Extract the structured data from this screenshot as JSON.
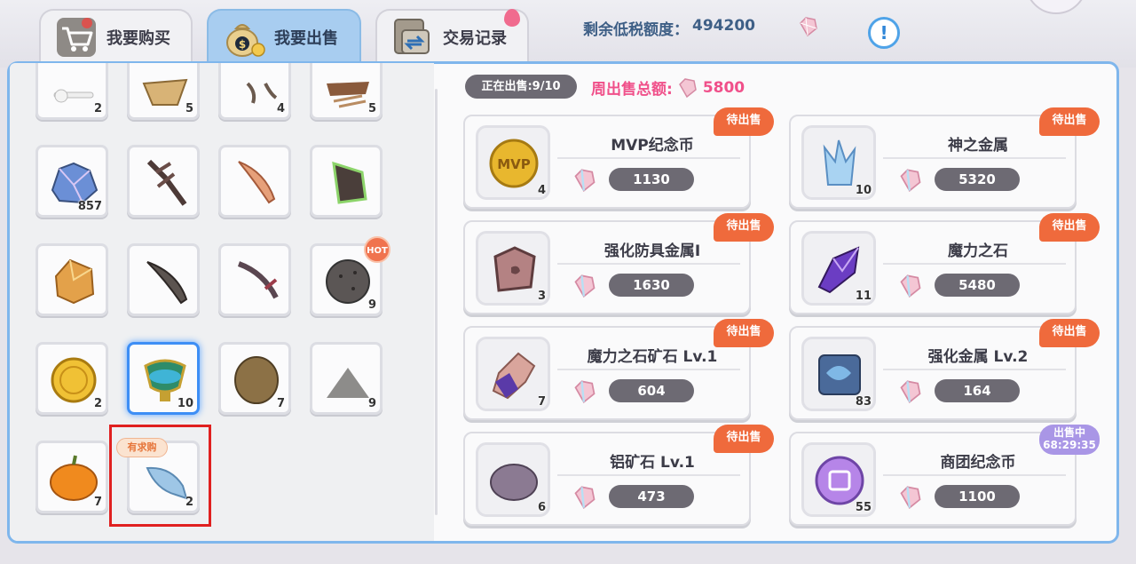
{
  "tabs": [
    {
      "label": "我要购买",
      "icon": "shopping-cart-icon"
    },
    {
      "label": "我要出售",
      "icon": "money-bag-icon"
    },
    {
      "label": "交易记录",
      "icon": "trade-record-icon"
    }
  ],
  "quota": {
    "label": "剩余低税额度：",
    "value": "494200"
  },
  "colors": {
    "accent": "#7fb6ec",
    "status_pending": "#ef6a3c",
    "status_selling": "#a996e6",
    "weekly_pink": "#f0508a"
  },
  "selling_status": "正在出售:9/10",
  "weekly_total": {
    "label": "周出售总额:",
    "value": "5800"
  },
  "inventory": {
    "hot_badge": "HOT",
    "buy_tag": "有求购",
    "slots": [
      {
        "icon": "bone-icon",
        "count": "2"
      },
      {
        "icon": "cloth-icon",
        "count": "5"
      },
      {
        "icon": "branch-icon",
        "count": "4"
      },
      {
        "icon": "wood-pile-icon",
        "count": "5"
      },
      {
        "icon": "crystal-ore-icon",
        "count": "857"
      },
      {
        "icon": "dark-sword-icon",
        "count": ""
      },
      {
        "icon": "flame-blade-icon",
        "count": ""
      },
      {
        "icon": "green-claw-icon",
        "count": ""
      },
      {
        "icon": "amber-stone-icon",
        "count": ""
      },
      {
        "icon": "scimitar-icon",
        "count": ""
      },
      {
        "icon": "dagger-icon",
        "count": ""
      },
      {
        "icon": "dark-orb-icon",
        "count": "9"
      },
      {
        "icon": "gold-coin-icon",
        "count": "2"
      },
      {
        "icon": "potion-cup-icon",
        "count": "10"
      },
      {
        "icon": "coconut-icon",
        "count": "7"
      },
      {
        "icon": "sand-pile-icon",
        "count": "9"
      },
      {
        "icon": "pumpkin-icon",
        "count": "7"
      },
      {
        "icon": "fish-icon",
        "count": "2"
      }
    ]
  },
  "listings": [
    {
      "name": "MVP纪念币",
      "count": "4",
      "price": "1130",
      "status": "待出售",
      "icon": "mvp-coin-icon"
    },
    {
      "name": "神之金属",
      "count": "10",
      "price": "5320",
      "status": "待出售",
      "icon": "ice-crystal-icon"
    },
    {
      "name": "强化防具金属Ⅰ",
      "count": "3",
      "price": "1630",
      "status": "待出售",
      "icon": "armor-metal-icon"
    },
    {
      "name": "魔力之石",
      "count": "11",
      "price": "5480",
      "status": "待出售",
      "icon": "purple-crystal-icon"
    },
    {
      "name": "魔力之石矿石 Lv.1",
      "count": "7",
      "price": "604",
      "status": "待出售",
      "icon": "purple-ore-icon"
    },
    {
      "name": "强化金属 Lv.2",
      "count": "83",
      "price": "164",
      "status": "待出售",
      "icon": "blue-metal-icon"
    },
    {
      "name": "铝矿石 Lv.1",
      "count": "6",
      "price": "473",
      "status": "待出售",
      "icon": "aluminum-ore-icon"
    },
    {
      "name": "商团纪念币",
      "count": "55",
      "price": "1100",
      "status_line1": "出售中",
      "status_line2": "68:29:35",
      "icon": "guild-coin-icon"
    }
  ]
}
